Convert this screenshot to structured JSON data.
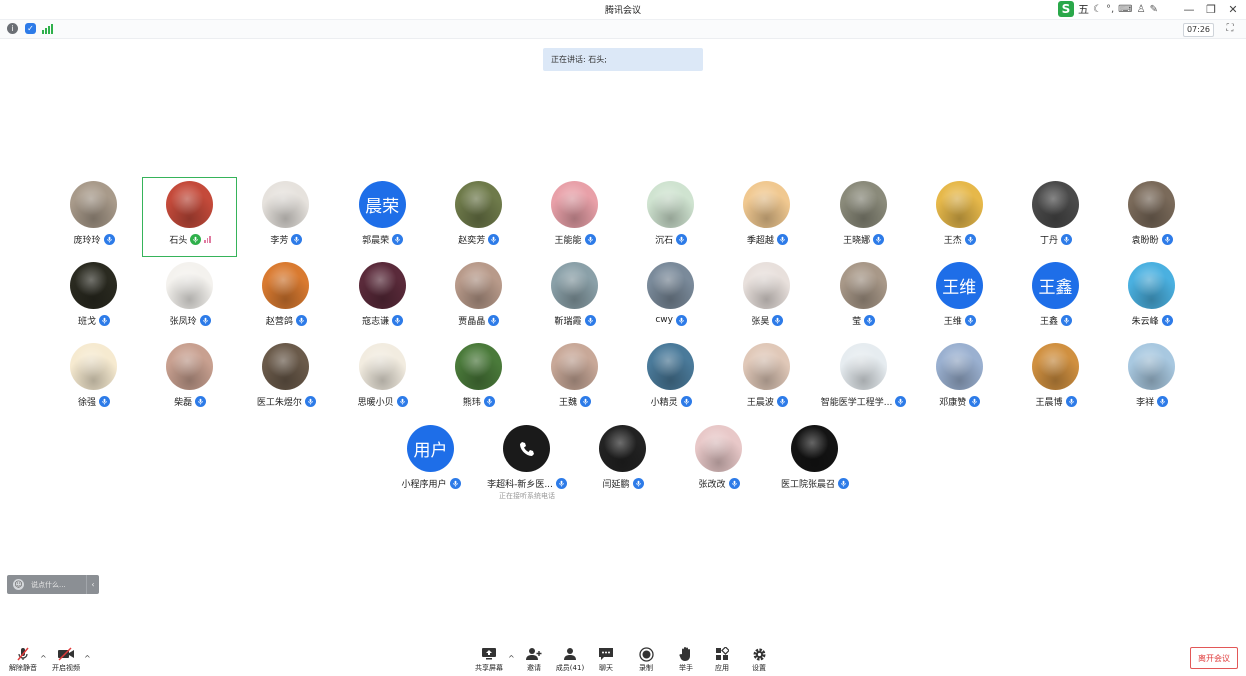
{
  "window": {
    "title": "腾讯会议"
  },
  "ime": {
    "logo": "S",
    "mode": "五"
  },
  "status": {
    "timer": "07:26"
  },
  "speaking": {
    "text": "正在讲话: 石头;"
  },
  "participants": [
    {
      "name": "庞玲玲",
      "color": "#a89a8a",
      "avatar": "photo"
    },
    {
      "name": "石头",
      "color": "#c44a3a",
      "avatar": "photo",
      "active": true,
      "mic": "green"
    },
    {
      "name": "李芳",
      "color": "#e6e2dd",
      "avatar": "photo"
    },
    {
      "name": "郭晨荣",
      "avatar": "text",
      "avatar_text": "晨荣"
    },
    {
      "name": "赵奕芳",
      "color": "#6e7a4a",
      "avatar": "photo"
    },
    {
      "name": "王能能",
      "color": "#e8a0a8",
      "avatar": "photo"
    },
    {
      "name": "沉石",
      "color": "#cfe3d0",
      "avatar": "photo"
    },
    {
      "name": "季超越",
      "color": "#f0c890",
      "avatar": "photo"
    },
    {
      "name": "王晓娜",
      "color": "#8a8a7a",
      "avatar": "photo"
    },
    {
      "name": "王杰",
      "color": "#e6b84a",
      "avatar": "photo"
    },
    {
      "name": "丁丹",
      "color": "#4a4a4a",
      "avatar": "photo"
    },
    {
      "name": "袁盼盼",
      "color": "#7a6a5a",
      "avatar": "photo"
    },
    {
      "name": "班戈",
      "color": "#2a2a20",
      "avatar": "photo"
    },
    {
      "name": "张凤玲",
      "color": "#f4f2ee",
      "avatar": "photo"
    },
    {
      "name": "赵营鸽",
      "color": "#d97a30",
      "avatar": "photo"
    },
    {
      "name": "寇志谦",
      "color": "#5a2a3a",
      "avatar": "photo"
    },
    {
      "name": "贾晶晶",
      "color": "#b89a8a",
      "avatar": "photo"
    },
    {
      "name": "靳瑞霞",
      "color": "#8aa0a8",
      "avatar": "photo"
    },
    {
      "name": "cwy",
      "color": "#7a8a9a",
      "avatar": "photo"
    },
    {
      "name": "张昊",
      "color": "#e8e0dc",
      "avatar": "photo"
    },
    {
      "name": "莹",
      "color": "#a89888",
      "avatar": "photo"
    },
    {
      "name": "王维",
      "avatar": "text",
      "avatar_text": "王维"
    },
    {
      "name": "王鑫",
      "avatar": "text",
      "avatar_text": "王鑫"
    },
    {
      "name": "朱云峰",
      "color": "#4ab0e0",
      "avatar": "photo"
    },
    {
      "name": "徐强",
      "color": "#f6ead0",
      "avatar": "photo"
    },
    {
      "name": "柴磊",
      "color": "#c8a090",
      "avatar": "photo"
    },
    {
      "name": "医工朱煜尔",
      "color": "#6a5a4a",
      "avatar": "photo"
    },
    {
      "name": "思暖小贝",
      "color": "#f2ece0",
      "avatar": "photo"
    },
    {
      "name": "熊玮",
      "color": "#4a7a3a",
      "avatar": "photo"
    },
    {
      "name": "王魏",
      "color": "#c8a898",
      "avatar": "photo"
    },
    {
      "name": "小精灵",
      "color": "#4a7a9a",
      "avatar": "photo"
    },
    {
      "name": "王晨波",
      "color": "#e0c8b8",
      "avatar": "photo"
    },
    {
      "name": "智能医学工程学...",
      "color": "#e6ecf0",
      "avatar": "photo"
    },
    {
      "name": "邓康赞",
      "color": "#9ab0d0",
      "avatar": "photo"
    },
    {
      "name": "王晨博",
      "color": "#d09040",
      "avatar": "photo"
    },
    {
      "name": "李祥",
      "color": "#a8c8e0",
      "avatar": "photo"
    },
    {
      "name": "小程序用户",
      "avatar": "text",
      "avatar_text": "用户"
    },
    {
      "name": "李超科-新乡医...",
      "avatar": "phone",
      "sub": "正在接听系统电话"
    },
    {
      "name": "闫延鹏",
      "color": "#222222",
      "avatar": "photo"
    },
    {
      "name": "张改改",
      "color": "#e8c8c8",
      "avatar": "photo"
    },
    {
      "name": "医工院张晨召",
      "color": "#141414",
      "avatar": "photo"
    }
  ],
  "chat": {
    "placeholder": "说点什么..."
  },
  "toolbar": {
    "mute": "解除静音",
    "video": "开启视频",
    "share": "共享屏幕",
    "invite": "邀请",
    "members": "成员(41)",
    "chat": "聊天",
    "record": "录制",
    "raise": "举手",
    "apps": "应用",
    "settings": "设置",
    "leave": "离开会议"
  },
  "colors": {
    "accent": "#1e6ee8",
    "active_border": "#36b35a",
    "leave": "#e03b3b"
  }
}
